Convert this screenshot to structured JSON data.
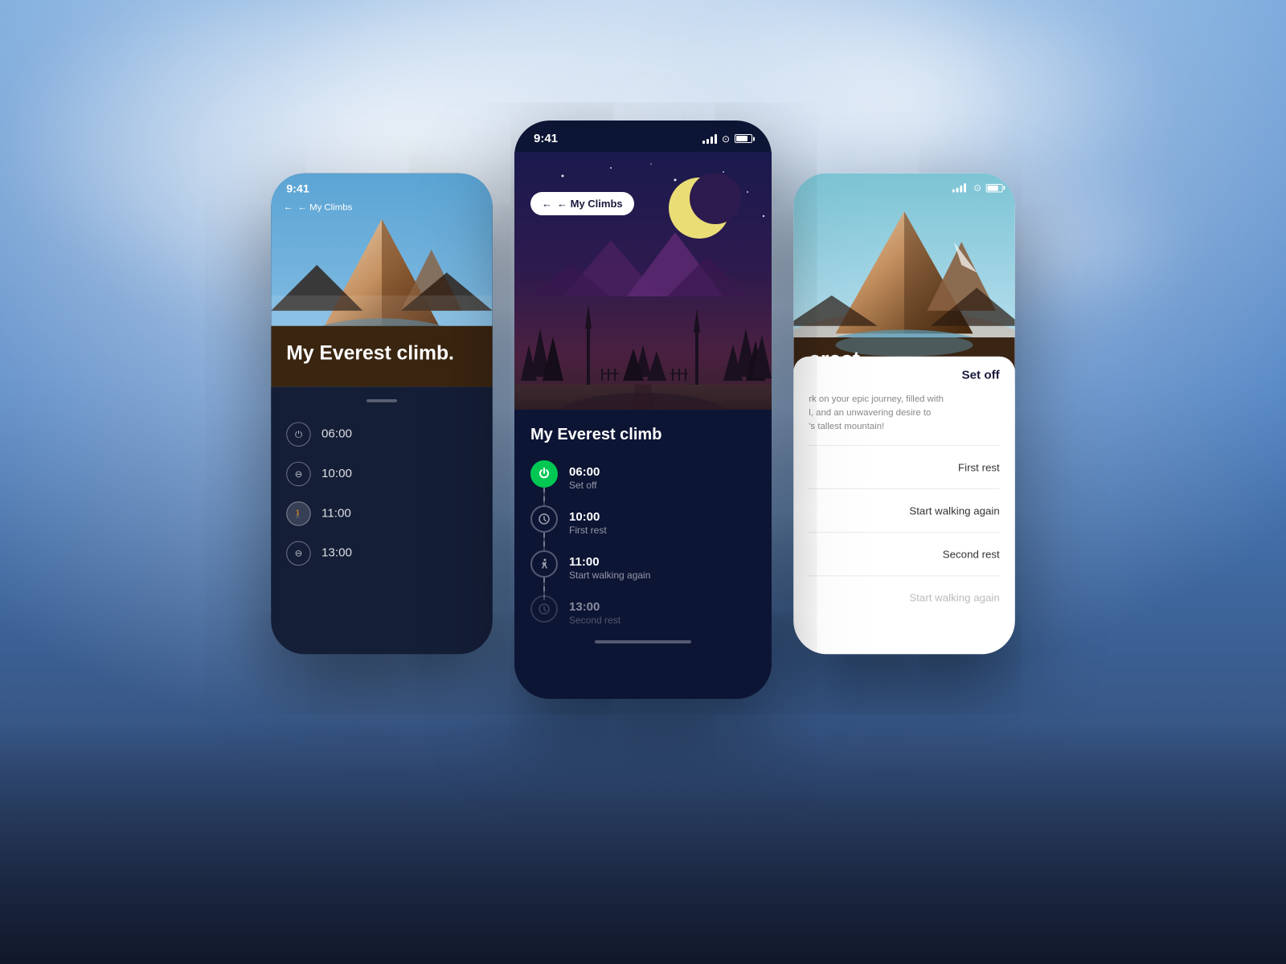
{
  "background": {
    "color": "#4a7fc1"
  },
  "phoneLeft": {
    "statusTime": "9:41",
    "backNav": "← My Climbs",
    "heroTitle": "My Everest climb.",
    "listItems": [
      {
        "icon": "power",
        "time": "06:00"
      },
      {
        "icon": "minus",
        "time": "10:00"
      },
      {
        "icon": "walk",
        "time": "11:00"
      },
      {
        "icon": "minus",
        "time": "13:00"
      }
    ]
  },
  "phoneCenter": {
    "statusTime": "9:41",
    "backLabel": "← My Climbs",
    "heroTitle": "My Everest climb",
    "timeline": [
      {
        "time": "06:00",
        "label": "Set off",
        "iconType": "power",
        "active": true
      },
      {
        "time": "10:00",
        "label": "First rest",
        "iconType": "clock",
        "active": false
      },
      {
        "time": "11:00",
        "label": "Start walking again",
        "iconType": "walk",
        "active": false
      },
      {
        "time": "13:00",
        "label": "Second rest",
        "iconType": "clock",
        "active": false
      }
    ]
  },
  "phoneRight": {
    "statusTime": "",
    "heroTitle": "erest",
    "sheet": {
      "title": "Set off",
      "description": "rk on your epic journey, filled with\nl, and an unwavering desire to\n's tallest mountain!",
      "items": [
        {
          "label": "First rest",
          "faded": false
        },
        {
          "label": "Start walking again",
          "faded": false
        },
        {
          "label": "Second rest",
          "faded": false
        },
        {
          "label": "Start walking again",
          "faded": true
        }
      ]
    }
  }
}
